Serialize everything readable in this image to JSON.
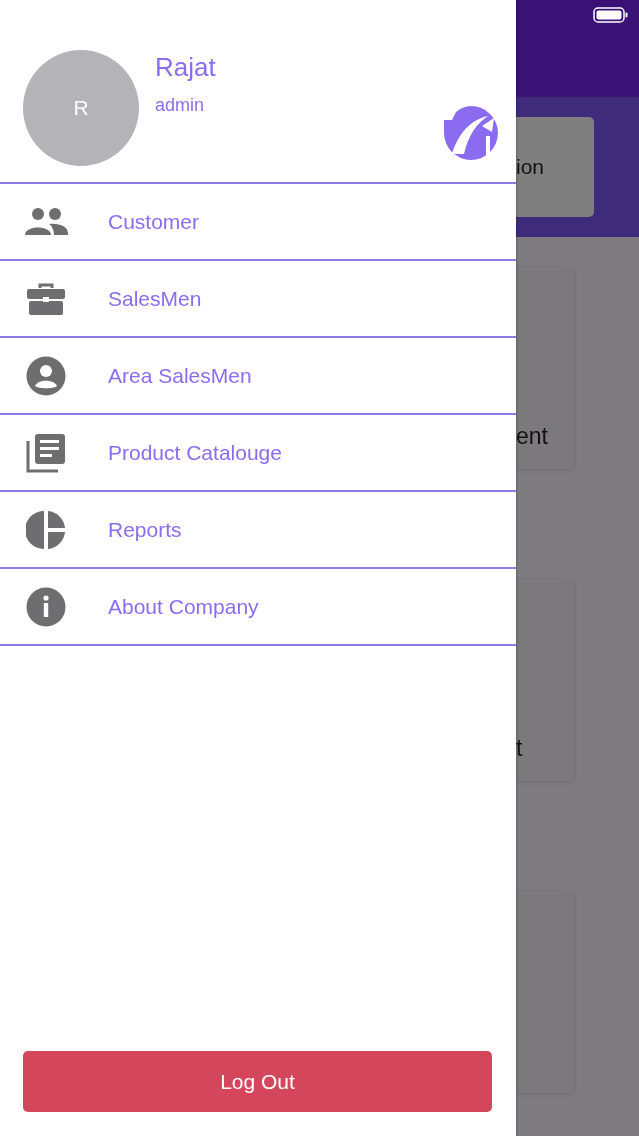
{
  "drawer": {
    "profile": {
      "initial": "R",
      "name": "Rajat",
      "role": "admin"
    },
    "menu": [
      {
        "label": "Customer"
      },
      {
        "label": "SalesMen"
      },
      {
        "label": "Area SalesMen"
      },
      {
        "label": "Product Catalouge"
      },
      {
        "label": "Reports"
      },
      {
        "label": "About Company"
      }
    ],
    "logout_button": "Log Out"
  },
  "background_page": {
    "header_card": "ion",
    "cards": [
      {
        "kind": "text",
        "text": "ent"
      },
      {
        "kind": "text",
        "text": "t"
      },
      {
        "kind": "blank"
      }
    ]
  }
}
